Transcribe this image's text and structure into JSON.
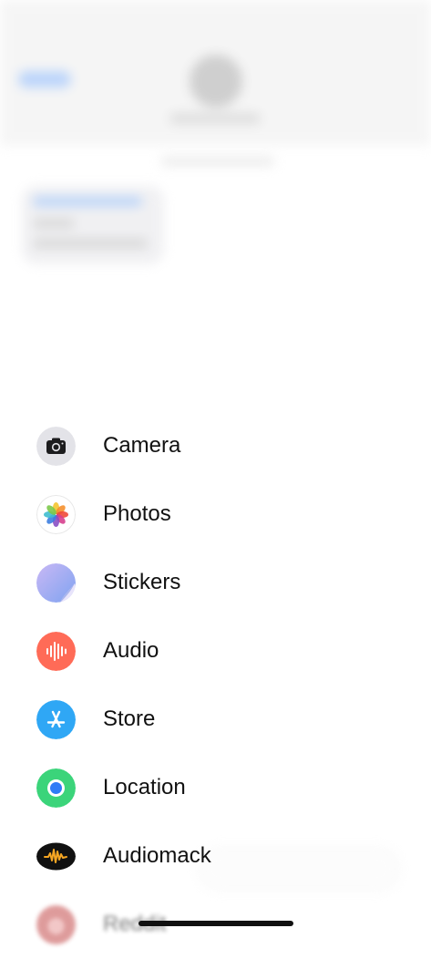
{
  "menu": {
    "items": [
      {
        "label": "Camera",
        "icon": "camera-icon",
        "color": "#e5e5ea"
      },
      {
        "label": "Photos",
        "icon": "photos-icon",
        "color": "#ffffff"
      },
      {
        "label": "Stickers",
        "icon": "stickers-icon",
        "color": "#b9b2f5"
      },
      {
        "label": "Audio",
        "icon": "audio-waveform-icon",
        "color": "#ff6b57"
      },
      {
        "label": "Store",
        "icon": "app-store-icon",
        "color": "#2fa7f5"
      },
      {
        "label": "Location",
        "icon": "location-icon",
        "color": "#3bd47a"
      },
      {
        "label": "Audiomack",
        "icon": "audiomack-icon",
        "color": "#111111"
      },
      {
        "label": "Reddit",
        "icon": "app-icon",
        "color": "#c44b4b"
      }
    ]
  },
  "colors": {
    "text": "#111111",
    "background": "#ffffff",
    "home_indicator": "#111111"
  }
}
